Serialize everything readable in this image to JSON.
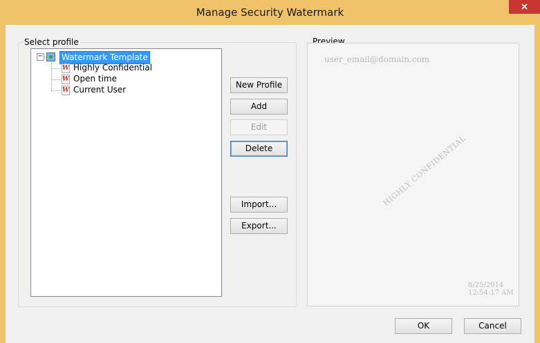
{
  "window": {
    "title": "Manage Security Watermark",
    "close_glyph": "×"
  },
  "select_profile": {
    "label": "Select profile",
    "tree": {
      "root": "Watermark Template",
      "expander": "−",
      "children": [
        {
          "label": "Highly Confidential",
          "icon": "W"
        },
        {
          "label": "Open time",
          "icon": "W"
        },
        {
          "label": "Current User",
          "icon": "W"
        }
      ]
    }
  },
  "buttons": {
    "new_profile": "New Profile",
    "add": "Add",
    "edit": "Edit",
    "delete": "Delete",
    "import": "Import...",
    "export": "Export...",
    "ok": "OK",
    "cancel": "Cancel"
  },
  "preview": {
    "label": "Preview",
    "email": "user_email@domain.com",
    "diagonal": "HIGHLY CONFIDENTIAL",
    "date": "8/25/2014",
    "time": "12:54:17 AM"
  }
}
